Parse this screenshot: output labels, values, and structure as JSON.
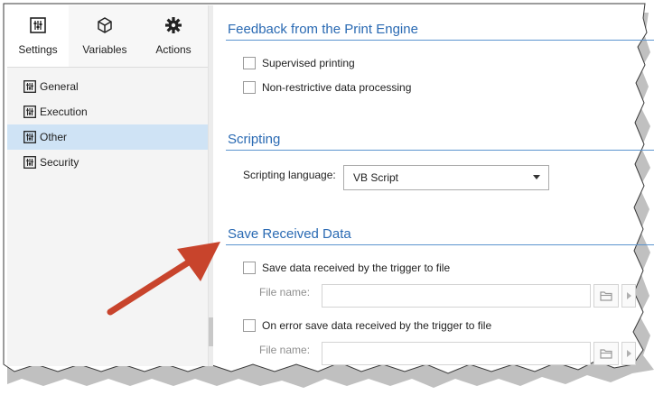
{
  "tabs": [
    {
      "label": "Settings",
      "icon": "sliders-icon",
      "active": true
    },
    {
      "label": "Variables",
      "icon": "cube-icon",
      "active": false
    },
    {
      "label": "Actions",
      "icon": "gear-icon",
      "active": false
    }
  ],
  "nav": {
    "items": [
      {
        "label": "General",
        "icon": "sliders-icon",
        "selected": false
      },
      {
        "label": "Execution",
        "icon": "sliders-icon",
        "selected": false
      },
      {
        "label": "Other",
        "icon": "sliders-icon",
        "selected": true
      },
      {
        "label": "Security",
        "icon": "sliders-icon",
        "selected": false
      }
    ]
  },
  "feedback": {
    "title": "Feedback from the Print Engine",
    "supervised_label": "Supervised printing",
    "nonrestrictive_label": "Non-restrictive data processing"
  },
  "scripting": {
    "title": "Scripting",
    "language_label": "Scripting language:",
    "language_value": "VB Script"
  },
  "save": {
    "title": "Save Received Data",
    "save_label": "Save data received by the trigger to file",
    "file_label_1": "File name:",
    "on_error_label": "On error save data received by the trigger to file",
    "file_label_2": "File name:"
  },
  "colors": {
    "accent": "#2a6ab3",
    "selection": "#cfe3f5",
    "arrow": "#c8442c"
  }
}
